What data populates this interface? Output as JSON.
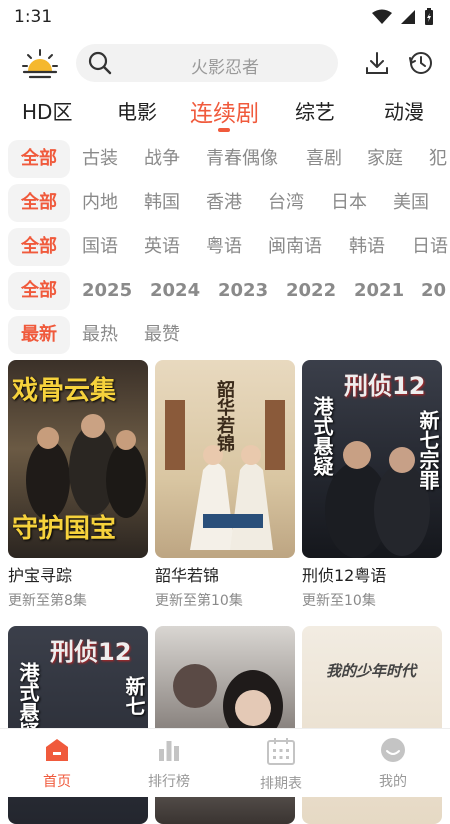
{
  "status": {
    "time": "1:31"
  },
  "search": {
    "placeholder": "火影忍者"
  },
  "tabs": [
    "HD区",
    "电影",
    "连续剧",
    "综艺",
    "动漫"
  ],
  "filters": {
    "genre": {
      "all": "全部",
      "items": [
        "古装",
        "战争",
        "青春偶像",
        "喜剧",
        "家庭",
        "犯"
      ]
    },
    "region": {
      "all": "全部",
      "items": [
        "内地",
        "韩国",
        "香港",
        "台湾",
        "日本",
        "美国"
      ]
    },
    "language": {
      "all": "全部",
      "items": [
        "国语",
        "英语",
        "粤语",
        "闽南语",
        "韩语",
        "日语"
      ]
    },
    "year": {
      "all": "全部",
      "items": [
        "2025",
        "2024",
        "2023",
        "2022",
        "2021",
        "20"
      ]
    },
    "sort": {
      "selected": "最新",
      "items": [
        "最热",
        "最赞"
      ]
    }
  },
  "cards": [
    {
      "title": "护宝寻踪",
      "subtitle": "更新至第8集",
      "poster_text": [
        "戏骨云集",
        "守护国宝"
      ]
    },
    {
      "title": "韶华若锦",
      "subtitle": "更新至第10集",
      "poster_text": [
        "韶华若锦"
      ]
    },
    {
      "title": "刑侦12粤语",
      "subtitle": "更新至10集",
      "poster_text": [
        "刑侦12",
        "港式悬疑",
        "新七宗罪"
      ]
    },
    {
      "title": "",
      "subtitle": "",
      "poster_text": [
        "刑侦12",
        "港式悬疑",
        "新七"
      ]
    },
    {
      "title": "",
      "subtitle": "",
      "poster_text": []
    },
    {
      "title": "",
      "subtitle": "",
      "poster_text": [
        "我的少年时代"
      ]
    }
  ],
  "bottom_nav": [
    "首页",
    "排行榜",
    "排期表",
    "我的"
  ],
  "colors": {
    "accent": "#f05a3c"
  }
}
